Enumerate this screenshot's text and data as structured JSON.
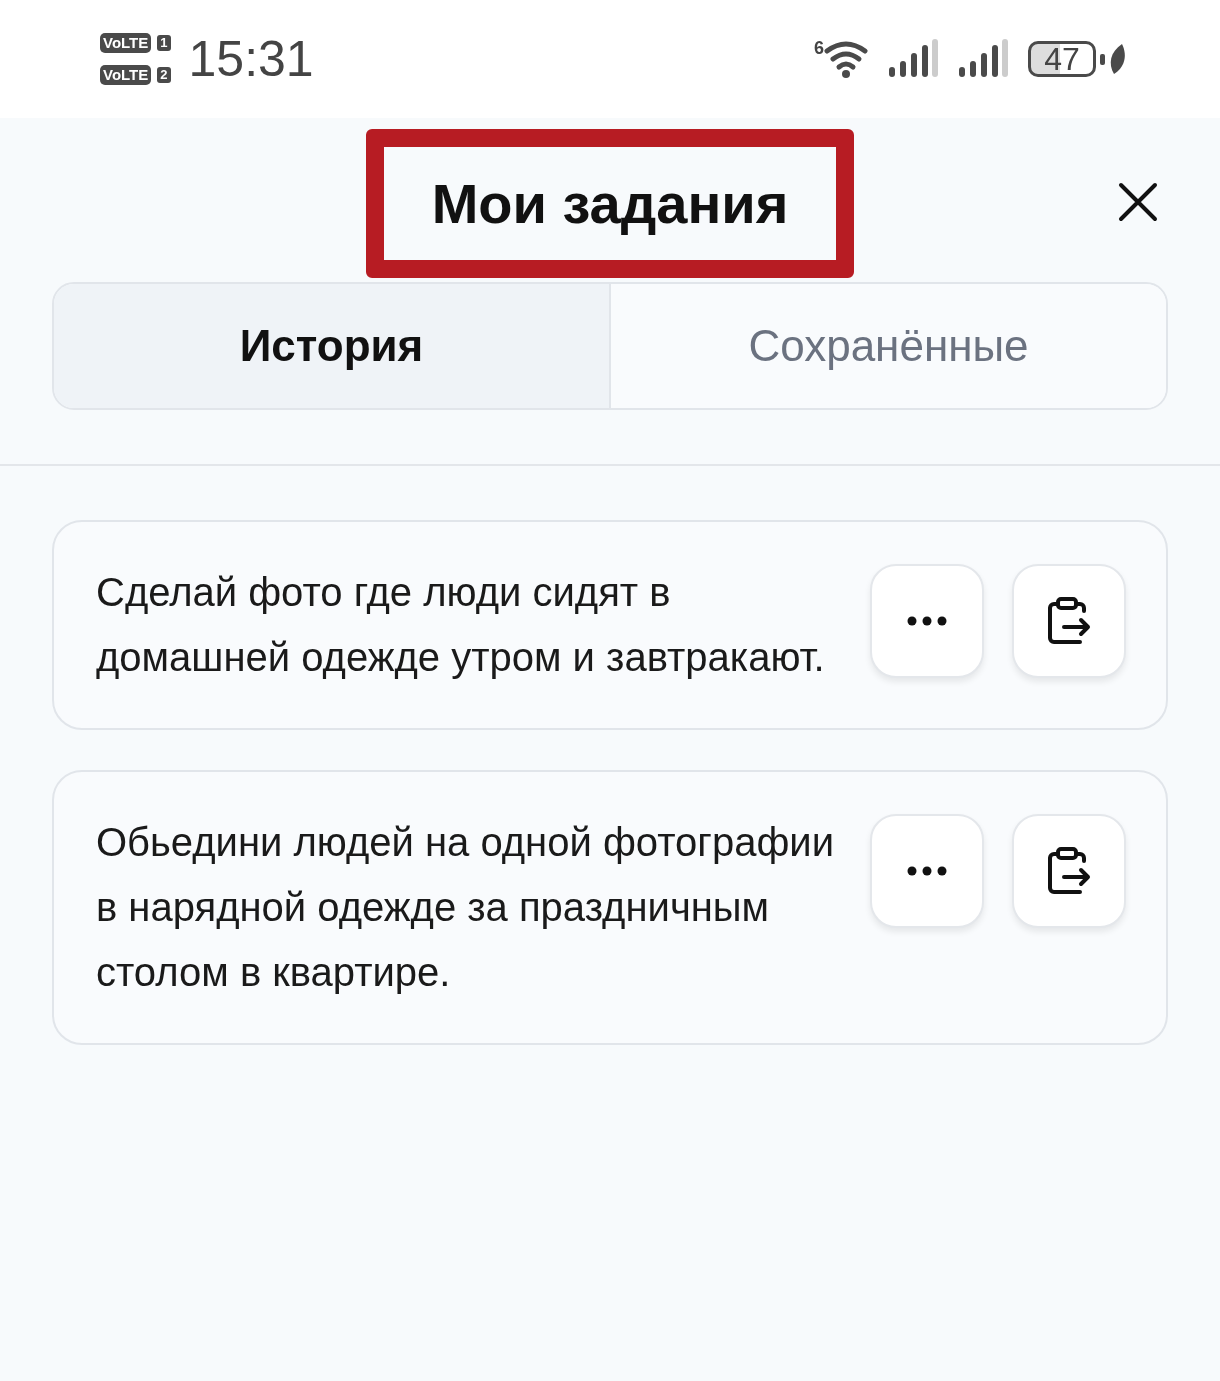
{
  "status_bar": {
    "sim_badges": [
      {
        "label": "VoLTE",
        "slot": "1"
      },
      {
        "label": "VoLTE",
        "slot": "2"
      }
    ],
    "time": "15:31",
    "wifi_label": "6",
    "battery": "47"
  },
  "header": {
    "title": "Мои задания",
    "highlighted": true
  },
  "tabs": [
    {
      "label": "История",
      "selected": true
    },
    {
      "label": "Сохранённые",
      "selected": false
    }
  ],
  "tasks": [
    {
      "text": "Сделай фото где люди сидят в домашней одежде утром и завтракают."
    },
    {
      "text": "Обьедини людей на одной фотографии в нарядной одежде за праздничным столом в квартире."
    }
  ]
}
